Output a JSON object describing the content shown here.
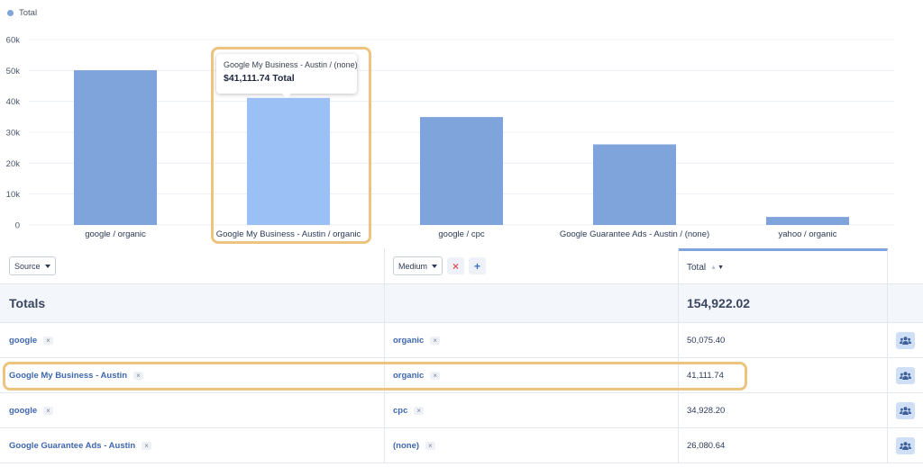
{
  "chart_data": {
    "type": "bar",
    "legend": [
      "Total"
    ],
    "categories": [
      "google / organic",
      "Google My Business - Austin / organic",
      "google / cpc",
      "Google Guarantee Ads - Austin / (none)",
      "yahoo / organic"
    ],
    "series": [
      {
        "name": "Total",
        "values": [
          50075.4,
          41111.74,
          34928.2,
          26080.64,
          2600
        ]
      }
    ],
    "ylim": [
      0,
      60000
    ],
    "yticks": [
      "0",
      "10k",
      "20k",
      "30k",
      "40k",
      "50k",
      "60k"
    ],
    "highlight_index": 1,
    "grid": true,
    "legend_position": "top-left",
    "colors": {
      "bar": "#7fa3db",
      "bar_highlight": "#9bc0f6"
    }
  },
  "tooltip": {
    "line1": "Google My Business - Austin / (none)",
    "line2": "$41,111.74 Total"
  },
  "table": {
    "source_select": "Source",
    "medium_select": "Medium",
    "remove_symbol": "×",
    "add_symbol": "+",
    "total_header": "Total",
    "sort_up": "▲",
    "sort_down": "▼",
    "totals_label": "Totals",
    "totals_value": "154,922.02",
    "rows": [
      {
        "source": "google",
        "medium": "organic",
        "total": "50,075.40"
      },
      {
        "source": "Google My Business - Austin",
        "medium": "organic",
        "total": "41,111.74"
      },
      {
        "source": "google",
        "medium": "cpc",
        "total": "34,928.20"
      },
      {
        "source": "Google Guarantee Ads - Austin",
        "medium": "(none)",
        "total": "26,080.64"
      }
    ]
  }
}
